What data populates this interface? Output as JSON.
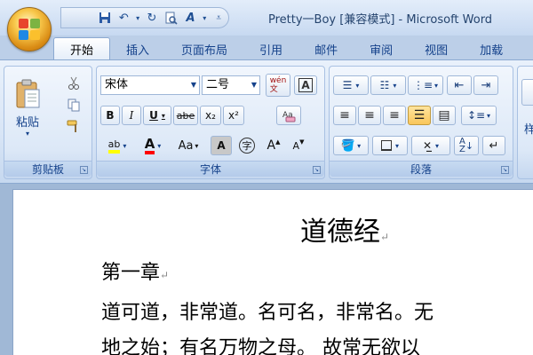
{
  "window": {
    "title": "Pretty一Boy [兼容模式] - Microsoft Word"
  },
  "tabs": [
    {
      "label": "开始",
      "active": true
    },
    {
      "label": "插入"
    },
    {
      "label": "页面布局"
    },
    {
      "label": "引用"
    },
    {
      "label": "邮件"
    },
    {
      "label": "审阅"
    },
    {
      "label": "视图"
    },
    {
      "label": "加载"
    }
  ],
  "clipboard": {
    "label": "剪贴板",
    "paste_label": "粘贴"
  },
  "font": {
    "label": "字体",
    "name": "宋体",
    "size": "二号",
    "bold": "B",
    "italic": "I",
    "underline": "U",
    "strike": "abe",
    "subscript": "x₂",
    "superscript": "x²",
    "aa": "Aa",
    "grow": "A",
    "shrink": "A",
    "phonetic": "wén\n文",
    "highlight_color": "#ffff00",
    "font_color": "#ff0000"
  },
  "paragraph": {
    "label": "段落",
    "side_label": "样"
  },
  "document": {
    "title": "道德经",
    "chapter": "第一章",
    "line1": "道可道，非常道。名可名，非常名。无",
    "line2": "地之始；有名万物之母。 故常无欲以"
  }
}
